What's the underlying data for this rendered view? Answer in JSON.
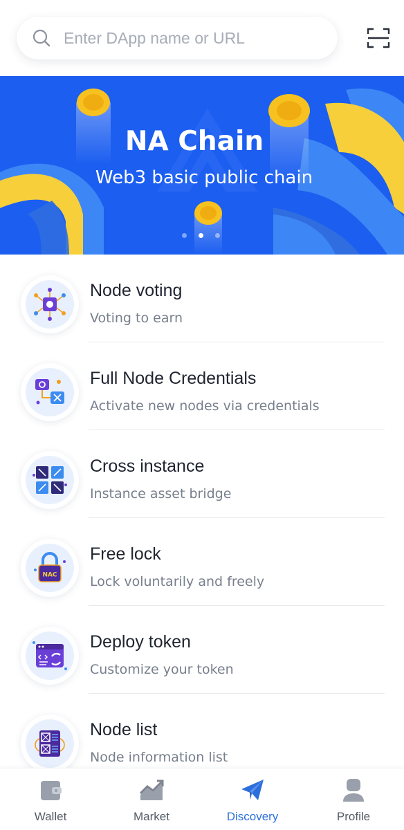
{
  "search": {
    "placeholder": "Enter DApp name or URL",
    "icon": "search-icon",
    "scan_icon": "scan-icon"
  },
  "banner": {
    "title": "NA Chain",
    "subtitle": "Web3 basic public chain",
    "slide_count": 3,
    "active_slide": 2,
    "colors": {
      "background": "#1b5ef0",
      "ribbon_yellow": "#f6cf3b",
      "ribbon_blue": "#3d86f5",
      "coin": "#f7c21f"
    }
  },
  "items": [
    {
      "title": "Node voting",
      "subtitle": "Voting to earn",
      "icon": "node-voting-icon"
    },
    {
      "title": "Full Node Credentials",
      "subtitle": "Activate new nodes via credentials",
      "icon": "full-node-credentials-icon"
    },
    {
      "title": "Cross instance",
      "subtitle": "Instance asset bridge",
      "icon": "cross-instance-icon"
    },
    {
      "title": "Free lock",
      "subtitle": "Lock voluntarily and freely",
      "icon": "free-lock-icon",
      "icon_text": "NAC"
    },
    {
      "title": "Deploy token",
      "subtitle": "Customize your token",
      "icon": "deploy-token-icon"
    },
    {
      "title": "Node list",
      "subtitle": "Node information list",
      "icon": "node-list-icon"
    }
  ],
  "nav": {
    "items": [
      {
        "label": "Wallet",
        "icon": "wallet-icon"
      },
      {
        "label": "Market",
        "icon": "market-chart-icon"
      },
      {
        "label": "Discovery",
        "icon": "paper-plane-icon"
      },
      {
        "label": "Profile",
        "icon": "profile-icon"
      }
    ],
    "active": "Discovery",
    "active_color": "#2b6fdc",
    "inactive_color": "#9aa0ab"
  }
}
